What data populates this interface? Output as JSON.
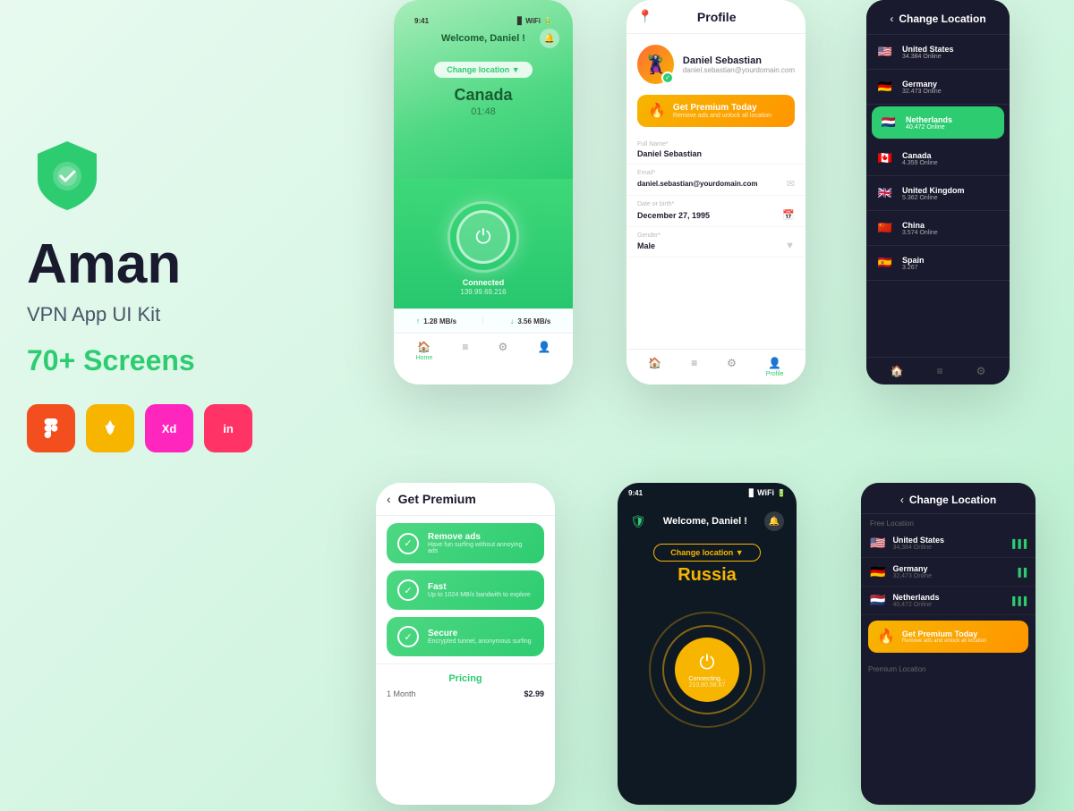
{
  "app": {
    "name": "Aman",
    "subtitle": "VPN App UI Kit",
    "screens": "70+ Screens"
  },
  "tools": [
    {
      "name": "Figma",
      "symbol": "F",
      "class": "tool-figma"
    },
    {
      "name": "Sketch",
      "symbol": "S",
      "class": "tool-sketch"
    },
    {
      "name": "XD",
      "symbol": "Xd",
      "class": "tool-xd"
    },
    {
      "name": "InVision",
      "symbol": "in",
      "class": "tool-invision"
    }
  ],
  "phone1": {
    "welcome": "Welcome, Daniel !",
    "location_btn": "Change location ▼",
    "country": "Canada",
    "time": "01:48",
    "status": "Connected",
    "ip": "139.99.69.216",
    "upload": "1.28 MB/s",
    "download": "3.56 MB/s",
    "nav": [
      "Home",
      "",
      "",
      ""
    ]
  },
  "phone2": {
    "title": "Profile",
    "user_name": "Daniel Sebastian",
    "user_email": "daniel.sebastian@yourdomain.com",
    "premium_title": "Get Premium Today",
    "premium_sub": "Remove ads and unlock all location",
    "fields": [
      {
        "label": "Full Name*",
        "value": "Daniel Sebastian"
      },
      {
        "label": "Email*",
        "value": "daniel.sebastian@yourdomain.com"
      },
      {
        "label": "Date or birth*",
        "value": "December 27, 1995"
      },
      {
        "label": "Gender*",
        "value": "Male"
      }
    ]
  },
  "phone3": {
    "title": "Change Location",
    "locations": [
      {
        "country": "United States",
        "count": "34.384 Online",
        "flag": "🇺🇸",
        "active": false
      },
      {
        "country": "Germany",
        "count": "32.473 Online",
        "flag": "🇩🇪",
        "active": false
      },
      {
        "country": "Netherlands",
        "count": "40.472 Online",
        "flag": "🇳🇱",
        "active": true
      },
      {
        "country": "Canada",
        "count": "4.359 Online",
        "flag": "🇨🇦",
        "active": false
      },
      {
        "country": "United Kingdom",
        "count": "5.362 Online",
        "flag": "🇬🇧",
        "active": false
      },
      {
        "country": "China",
        "count": "3.574 Online",
        "flag": "🇨🇳",
        "active": false
      },
      {
        "country": "Spain",
        "count": "3.267",
        "flag": "🇪🇸",
        "active": false
      }
    ]
  },
  "phone4": {
    "title": "Get Premium",
    "features": [
      {
        "title": "Remove ads",
        "sub": "Have fun surfing without annoying ads"
      },
      {
        "title": "Fast",
        "sub": "Up to 1024 MB/s bandwith to explore"
      },
      {
        "title": "Secure",
        "sub": "Encrypted tunnel, anonymous surfing"
      }
    ],
    "pricing_label": "Pricing",
    "plans": [
      {
        "name": "1 Month",
        "price": "$2.99"
      }
    ]
  },
  "phone5": {
    "welcome": "Welcome, Daniel !",
    "location_btn": "Change location ▼",
    "country": "Russia",
    "status": "Connecting...",
    "ip": "210.80.58.67"
  },
  "phone6": {
    "title": "Change Location",
    "free_label": "Free Location",
    "premium_label": "Premium Location",
    "free_locations": [
      {
        "country": "United States",
        "count": "34,384 Online",
        "flag": "🇺🇸"
      },
      {
        "country": "Germany",
        "count": "32,473 Online",
        "flag": "🇩🇪"
      },
      {
        "country": "Netherlands",
        "count": "40,472 Online",
        "flag": "🇳🇱"
      }
    ],
    "premium_btn_title": "Get Premium Today",
    "premium_btn_sub": "Remove ads and unlock all location"
  }
}
